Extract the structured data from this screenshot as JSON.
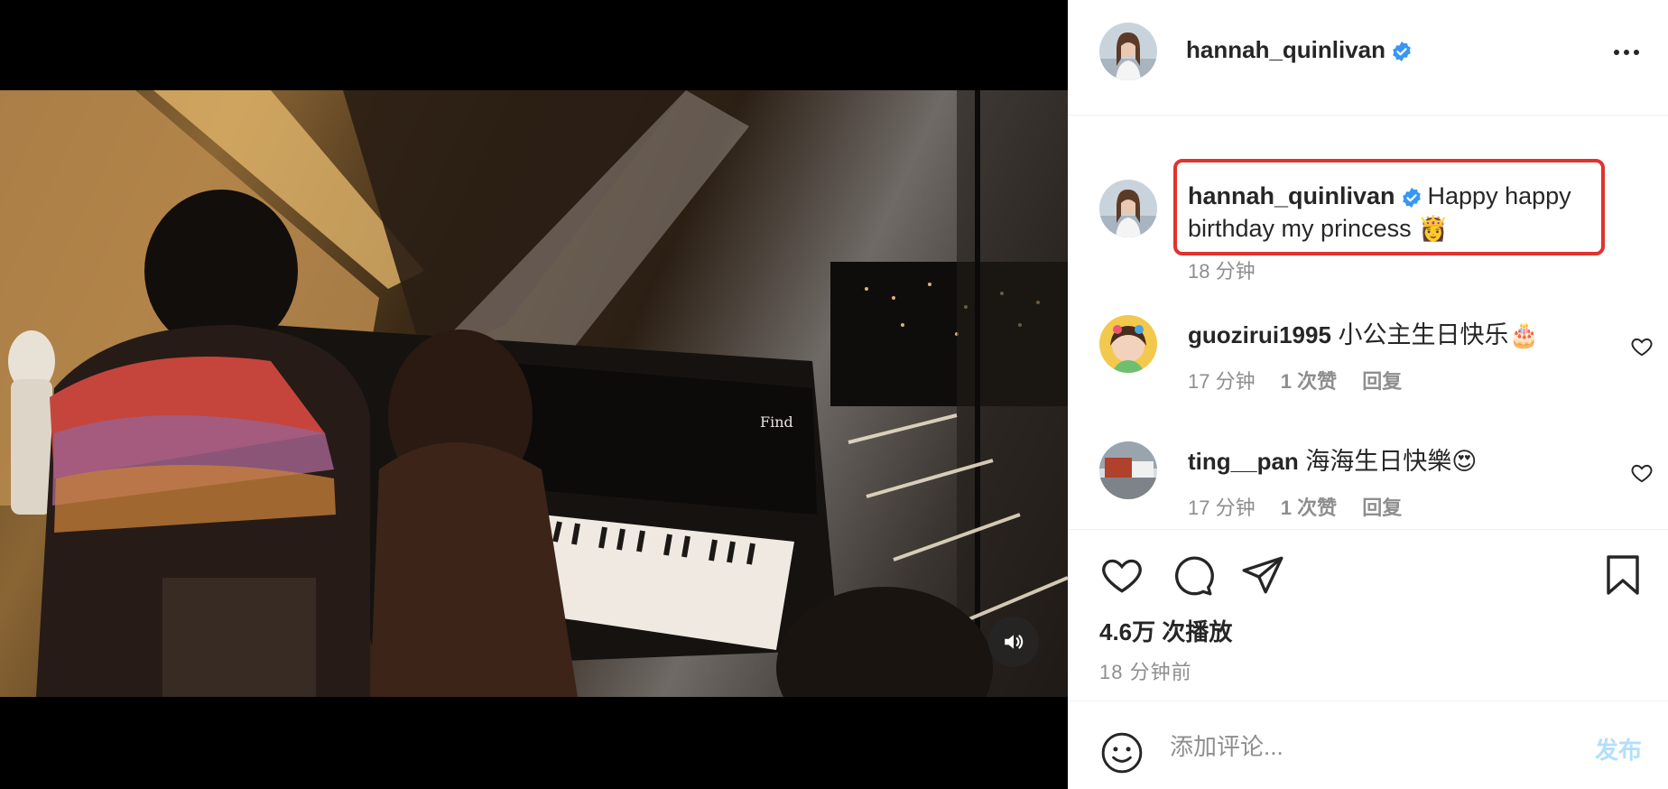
{
  "post": {
    "author": "hannah_quinlivan",
    "verified": true,
    "views": "4.6万 次播放",
    "posted_ago": "18 分钟前"
  },
  "caption": {
    "author": "hannah_quinlivan",
    "text": "Happy happy birthday my princess 👸",
    "time": "18 分钟"
  },
  "comments": [
    {
      "author": "guozirui1995",
      "text": "小公主生日快乐🎂",
      "time": "17 分钟",
      "likes": "1 次赞",
      "reply": "回复"
    },
    {
      "author": "ting__pan",
      "text": "海海生日快樂😍",
      "time": "17 分钟",
      "likes": "1 次赞",
      "reply": "回复"
    }
  ],
  "piano_label": "Find",
  "add_comment": {
    "placeholder": "添加评论...",
    "post_label": "发布"
  },
  "icons": [
    "volume-icon",
    "more-icon",
    "verified-icon",
    "heart-icon",
    "comment-icon",
    "share-icon",
    "bookmark-icon",
    "emoji-icon"
  ],
  "colors": {
    "highlight_border": "#e0332f",
    "verified_blue": "#3897f0",
    "post_disabled": "#b2dffc",
    "muted_text": "#8e8e8e"
  }
}
